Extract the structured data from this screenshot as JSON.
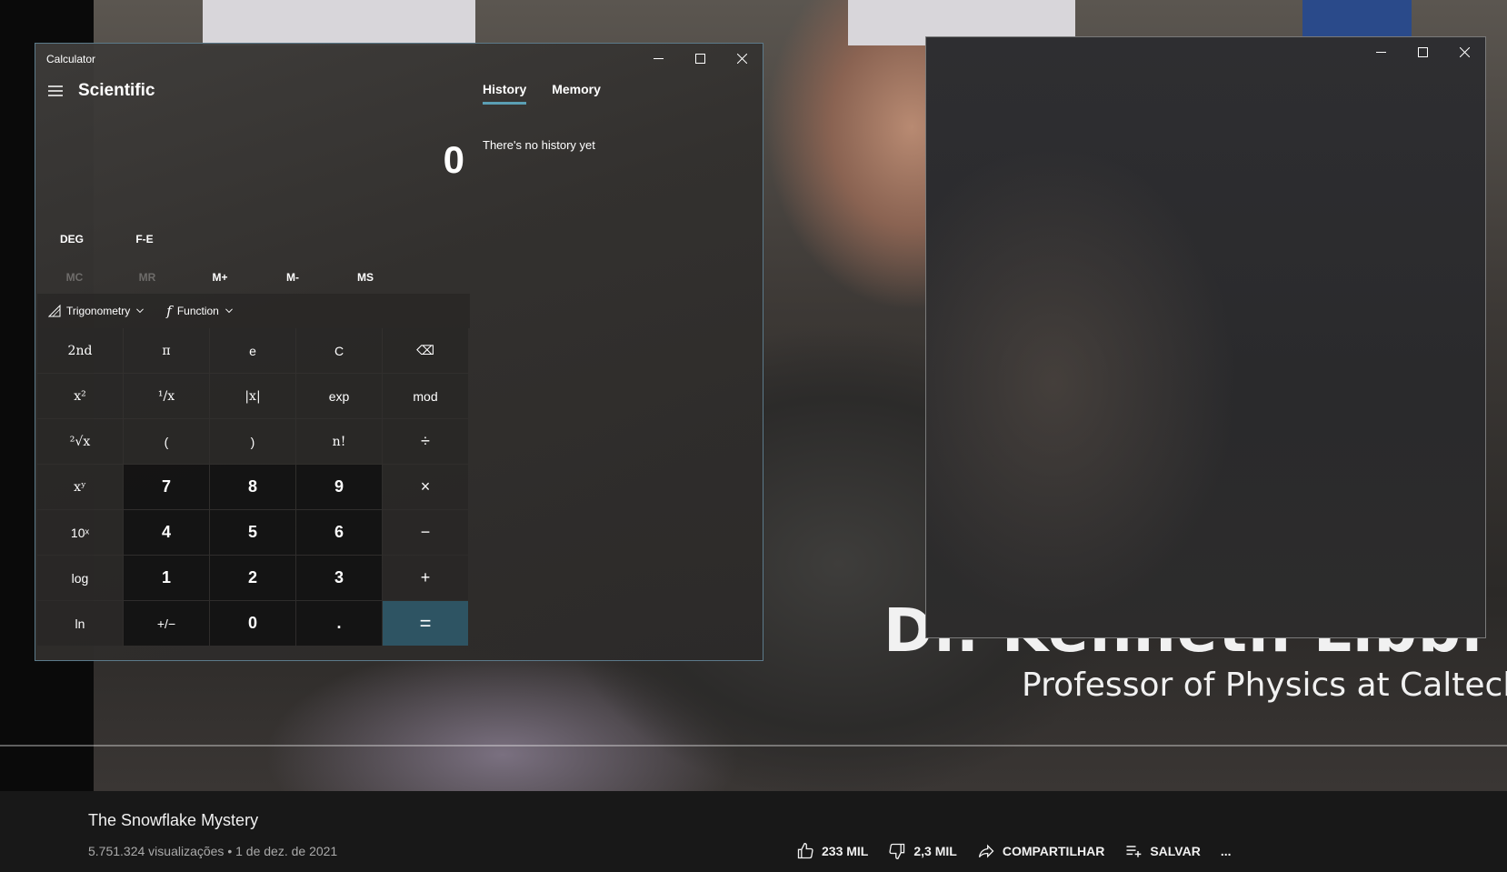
{
  "video": {
    "caption_name": "Dr. Kenneth Libbrecht",
    "caption_role": "Professor of Physics at Caltech"
  },
  "youtube": {
    "title": "The Snowflake Mystery",
    "meta": "5.751.324 visualizações • 1 de dez. de 2021",
    "likes": "233 MIL",
    "dislikes": "2,3 MIL",
    "share": "COMPARTILHAR",
    "save": "SALVAR",
    "more": "..."
  },
  "calculator": {
    "window_title": "Calculator",
    "mode_title": "Scientific",
    "display": "0",
    "angle_mode": "DEG",
    "fe_label": "F-E",
    "memory_buttons": [
      "MC",
      "MR",
      "M+",
      "M-",
      "MS"
    ],
    "trig_label": "Trigonometry",
    "function_label": "Function",
    "tabs": [
      "History",
      "Memory"
    ],
    "history_empty": "There's no history yet",
    "keys": [
      [
        "2nd",
        "π",
        "e",
        "C",
        "⌫"
      ],
      [
        "x²",
        "¹/x",
        "|x|",
        "exp",
        "mod"
      ],
      [
        "²√x",
        "(",
        ")",
        "n!",
        "÷"
      ],
      [
        "xʸ",
        "7",
        "8",
        "9",
        "×"
      ],
      [
        "10ˣ",
        "4",
        "5",
        "6",
        "−"
      ],
      [
        "log",
        "1",
        "2",
        "3",
        "+"
      ],
      [
        "ln",
        "+/−",
        "0",
        ".",
        "="
      ]
    ]
  },
  "colors": {
    "accent": "#5b9fb4",
    "equals_key": "#2e5463",
    "youtube_bar": "#181818"
  }
}
